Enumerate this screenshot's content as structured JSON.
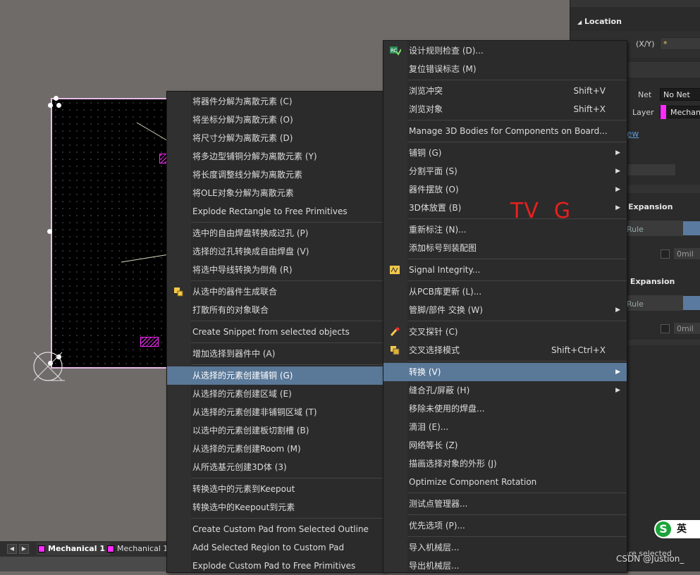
{
  "properties": {
    "section_location": "Location",
    "xy_label": "(X/Y)",
    "xy_value": "*",
    "net_label": "Net",
    "net_value": "No Net",
    "layer_label": "Layer",
    "layer_value": "Mechan",
    "link_partial": "ew",
    "expansion1": "Expansion",
    "rule1": "Rule",
    "mil1": "0mil",
    "expansion2": "x Expansion",
    "rule2": "Rule",
    "mil2": "0mil",
    "status_partial": "are selected"
  },
  "tabs": {
    "active": "Mechanical 1",
    "inactive": "Mechanical 1"
  },
  "annotation": "TV  G",
  "ime": {
    "logo": "S",
    "text": "英"
  },
  "watermark": "CSDN @Justion_",
  "menu_left": {
    "groups": [
      [
        {
          "label": "将器件分解为离散元素 (C)"
        },
        {
          "label": "将坐标分解为离散元素 (O)"
        },
        {
          "label": "将尺寸分解为离散元素 (D)"
        },
        {
          "label": "将多边型铺铜分解为离散元素 (Y)"
        },
        {
          "label": "将长度调整线分解为离散元素"
        },
        {
          "label": "将OLE对象分解为离散元素"
        },
        {
          "label": "Explode Rectangle to Free Primitives"
        }
      ],
      [
        {
          "label": "选中的自由焊盘转换成过孔 (P)"
        },
        {
          "label": "选择的过孔转换成自由焊盘 (V)"
        },
        {
          "label": "将选中导线转换为倒角 (R)"
        }
      ],
      [
        {
          "label": "从选中的器件生成联合",
          "icon": "union-icon"
        },
        {
          "label": "打散所有的对象联合"
        }
      ],
      [
        {
          "label": "Create Snippet from selected objects"
        }
      ],
      [
        {
          "label": "增加选择到器件中 (A)"
        }
      ],
      [
        {
          "label": "从选择的元素创建铺铜 (G)",
          "highlight": true
        },
        {
          "label": "从选择的元素创建区域 (E)"
        },
        {
          "label": "从选择的元素创建非铺铜区域 (T)"
        },
        {
          "label": "以选中的元素创建板切割槽 (B)"
        },
        {
          "label": "从选择的元素创建Room (M)"
        },
        {
          "label": "从所选基元创建3D体 (3)"
        }
      ],
      [
        {
          "label": "转换选中的元素到Keepout"
        },
        {
          "label": "转换选中的Keepout到元素"
        }
      ],
      [
        {
          "label": "Create Custom Pad from Selected Outline"
        },
        {
          "label": "Add Selected Region to Custom Pad"
        },
        {
          "label": "Explode Custom Pad to Free Primitives"
        }
      ]
    ]
  },
  "menu_right": {
    "groups": [
      [
        {
          "label": "设计规则检查 (D)...",
          "icon": "drc-icon"
        },
        {
          "label": "复位错误标志 (M)"
        }
      ],
      [
        {
          "label": "浏览冲突",
          "shortcut": "Shift+V"
        },
        {
          "label": "浏览对象",
          "shortcut": "Shift+X"
        }
      ],
      [
        {
          "label": "Manage 3D Bodies for Components on Board..."
        }
      ],
      [
        {
          "label": "铺铜 (G)",
          "submenu": true
        },
        {
          "label": "分割平面 (S)",
          "submenu": true
        },
        {
          "label": "器件摆放 (O)",
          "submenu": true
        },
        {
          "label": "3D体放置 (B)",
          "submenu": true
        }
      ],
      [
        {
          "label": "重新标注 (N)..."
        },
        {
          "label": "添加标号到装配图"
        }
      ],
      [
        {
          "label": "Signal Integrity...",
          "icon": "signal-integrity-icon"
        }
      ],
      [
        {
          "label": "从PCB库更新 (L)..."
        },
        {
          "label": "管脚/部件 交换 (W)",
          "submenu": true
        }
      ],
      [
        {
          "label": "交叉探针 (C)",
          "icon": "cross-probe-icon"
        },
        {
          "label": "交叉选择模式",
          "shortcut": "Shift+Ctrl+X",
          "icon": "cross-select-icon"
        }
      ],
      [
        {
          "label": "转换 (V)",
          "submenu": true,
          "highlight": true
        },
        {
          "label": "缝合孔/屏蔽 (H)",
          "submenu": true
        },
        {
          "label": "移除未使用的焊盘..."
        },
        {
          "label": "滴泪 (E)..."
        },
        {
          "label": "网络等长 (Z)"
        },
        {
          "label": "描画选择对象的外形 (J)"
        },
        {
          "label": "Optimize Component Rotation"
        }
      ],
      [
        {
          "label": "测试点管理器..."
        }
      ],
      [
        {
          "label": "优先选项 (P)..."
        }
      ],
      [
        {
          "label": "导入机械层..."
        },
        {
          "label": "导出机械层..."
        }
      ]
    ]
  }
}
